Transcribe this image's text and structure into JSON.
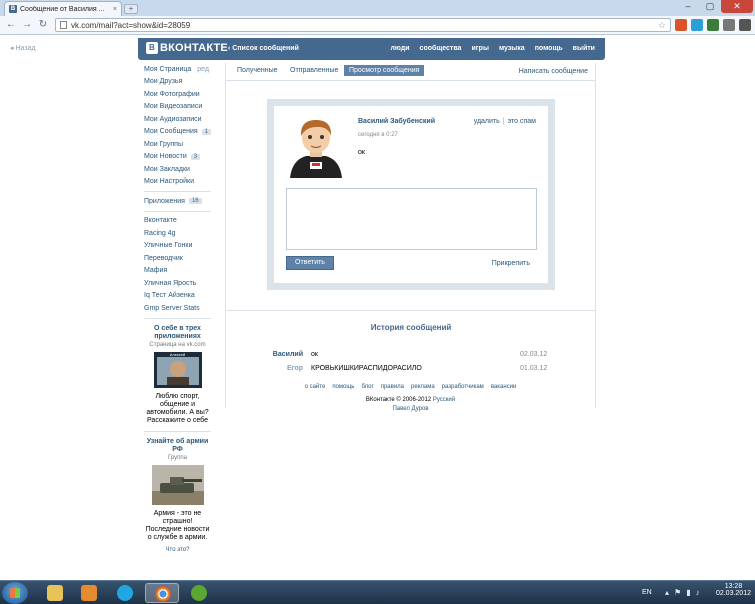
{
  "browser": {
    "tab_title": "Сообщение от Василия ...",
    "tab_close": "×",
    "new_tab": "+",
    "url": "vk.com/mail?act=show&id=28059",
    "window_buttons": [
      "–",
      "▢",
      "✕"
    ]
  },
  "header": {
    "back_link": "Назад",
    "logo": "ВКОНТАКТЕ",
    "logo_mark": "В",
    "breadcrumb": "‹ Список сообщений",
    "nav": [
      "люди",
      "сообщества",
      "игры",
      "музыка",
      "помощь",
      "выйти"
    ]
  },
  "left_menu": {
    "items": [
      {
        "label": "Моя Страница",
        "edit": "ред."
      },
      {
        "label": "Мои Друзья"
      },
      {
        "label": "Мои Фотографии"
      },
      {
        "label": "Мои Видеозаписи"
      },
      {
        "label": "Мои Аудиозаписи"
      },
      {
        "label": "Мои Сообщения",
        "count": "1"
      },
      {
        "label": "Мои Группы"
      },
      {
        "label": "Мои Новости",
        "count": "3"
      },
      {
        "label": "Мои Закладки"
      },
      {
        "label": "Мои Настройки"
      }
    ],
    "apps_label": "Приложения",
    "apps_count": "16",
    "apps": [
      "Вконтакте",
      "Racing 4g",
      "Уличные Гонки",
      "Переводчик",
      "Мафия",
      "Уличная Ярость",
      "Iq Тест Айзенка",
      "Gmp Server Stats"
    ]
  },
  "promo1": {
    "title": "О себе в трех приложениях",
    "subtitle": "Страница на vk.com",
    "image_caption": "Алексей",
    "desc": "Люблю спорт, общение и автомобили. А вы? Расскажите о себе"
  },
  "promo2": {
    "title": "Узнайте об армии РФ",
    "subtitle": "Группа",
    "desc": "Армия - это не страшно! Последние новости о службе в армии.",
    "whats_this": "Что это?"
  },
  "tabs": {
    "items": [
      "Полученные",
      "Отправленные",
      "Просмотр сообщения"
    ],
    "compose": "Написать сообщение"
  },
  "message": {
    "sender": "Василий Забубенский",
    "delete": "удалить",
    "spam": "это спам",
    "time": "сегодня в 0:27",
    "text": "ок",
    "reply_placeholder": "",
    "send_button": "Ответить",
    "attach": "Прикрепить"
  },
  "history": {
    "title": "История сообщений",
    "rows": [
      {
        "who": "Василий",
        "text": "ок",
        "date": "02.03.12"
      },
      {
        "who": "Егор",
        "text": "КРОВЬКИШКИРАСПИДОРАСИЛО",
        "date": "01.03.12"
      }
    ]
  },
  "footer": {
    "links": [
      "о сайте",
      "помощь",
      "блог",
      "правила",
      "реклама",
      "разработчикам",
      "вакансии"
    ],
    "copyright": "ВКонтакте © 2006-2012",
    "language": "Русский",
    "author": "Павел Дуров"
  },
  "taskbar": {
    "language": "EN",
    "time": "13:28",
    "date": "02.03.2012"
  },
  "colors": {
    "brand": "#45688e",
    "link": "#2b587a",
    "active_tab": "#5e82a8"
  }
}
